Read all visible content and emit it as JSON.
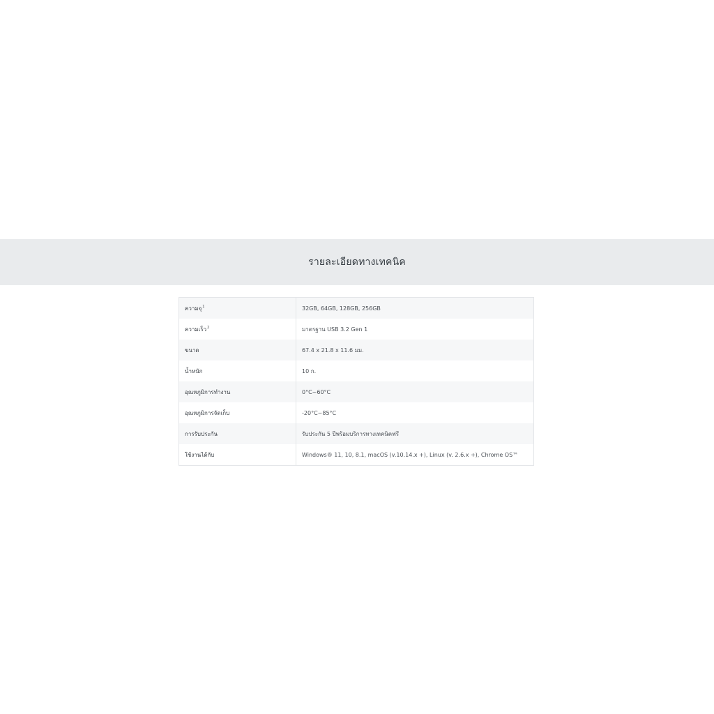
{
  "section": {
    "title": "รายละเอียดทางเทคนิค"
  },
  "specs": [
    {
      "label": "ความจุ",
      "label_sup": "1",
      "value": "32GB, 64GB, 128GB, 256GB"
    },
    {
      "label": "ความเร็ว",
      "label_sup": "2",
      "value": "มาตรฐาน USB 3.2 Gen 1"
    },
    {
      "label": "ขนาด",
      "label_sup": "",
      "value": "67.4 x 21.8 x 11.6 มม."
    },
    {
      "label": "น้ำหนัก",
      "label_sup": "",
      "value": "10 ก."
    },
    {
      "label": "อุณหภูมิการทำงาน",
      "label_sup": "",
      "value": "0°C~60°C"
    },
    {
      "label": "อุณหภูมิการจัดเก็บ",
      "label_sup": "",
      "value": "-20°C~85°C"
    },
    {
      "label": "การรับประกัน",
      "label_sup": "",
      "value": "รับประกัน 5 ปีพร้อมบริการทางเทคนิคฟรี"
    },
    {
      "label": "ใช้งานได้กับ",
      "label_sup": "",
      "value": "Windows® 11, 10, 8.1, macOS (v.10.14.x +), Linux (v. 2.6.x +), Chrome OS™"
    }
  ],
  "colors": {
    "banner_bg": "#e9ebed",
    "row_alt_bg": "#f6f7f8",
    "border": "#e3e5e8"
  }
}
